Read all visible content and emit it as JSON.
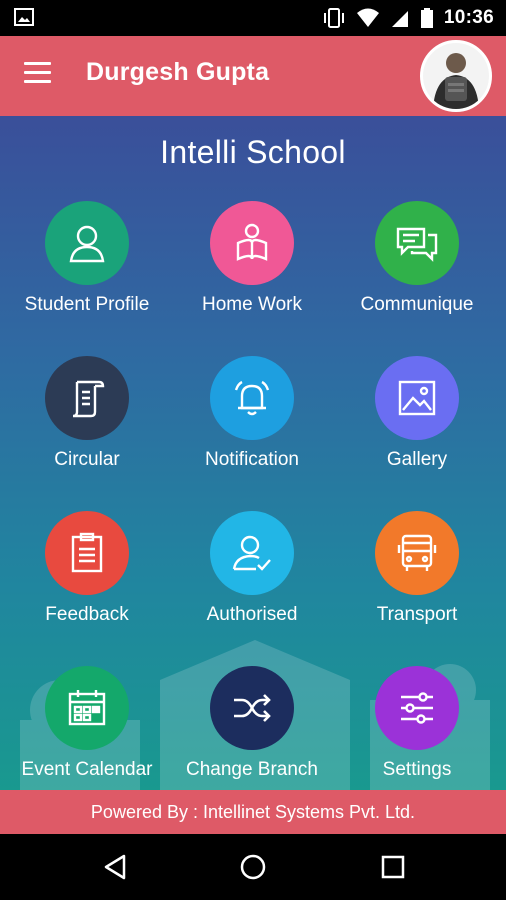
{
  "status_bar": {
    "time": "10:36"
  },
  "app_bar": {
    "user_name": "Durgesh Gupta"
  },
  "school": {
    "name": "Intelli School"
  },
  "menu": [
    {
      "label": "Student Profile",
      "icon": "user-icon",
      "color": "#1aa37a"
    },
    {
      "label": "Home Work",
      "icon": "reading-icon",
      "color": "#f05896"
    },
    {
      "label": "Communique",
      "icon": "chat-icon",
      "color": "#30b14a"
    },
    {
      "label": "Circular",
      "icon": "scroll-icon",
      "color": "#2c3b55"
    },
    {
      "label": "Notification",
      "icon": "bell-icon",
      "color": "#1e9fe0"
    },
    {
      "label": "Gallery",
      "icon": "image-icon",
      "color": "#6a6ef2"
    },
    {
      "label": "Feedback",
      "icon": "clipboard-icon",
      "color": "#e84a3f"
    },
    {
      "label": "Authorised",
      "icon": "user-check-icon",
      "color": "#22b6e6"
    },
    {
      "label": "Transport",
      "icon": "bus-icon",
      "color": "#f2792a"
    },
    {
      "label": "Event Calendar",
      "icon": "calendar-icon",
      "color": "#14a86b"
    },
    {
      "label": "Change Branch",
      "icon": "shuffle-icon",
      "color": "#1c2d5e"
    },
    {
      "label": "Settings",
      "icon": "sliders-icon",
      "color": "#9b32d8"
    }
  ],
  "footer": {
    "text": "Powered By : Intellinet Systems Pvt. Ltd."
  }
}
